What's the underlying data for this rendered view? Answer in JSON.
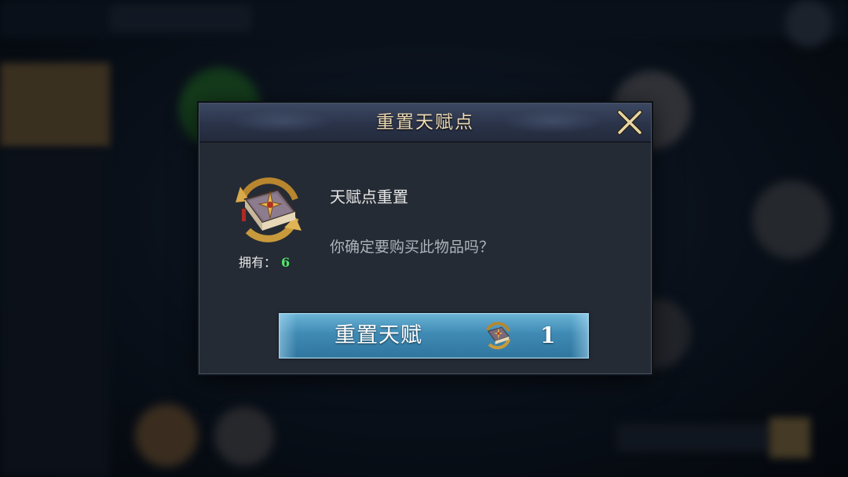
{
  "dialog": {
    "title": "重置天赋点",
    "close_icon": "close-x-icon",
    "item": {
      "icon": "talent-book-icon",
      "name": "天赋点重置",
      "owned_label": "拥有：",
      "owned_count": "6"
    },
    "confirm_text": "你确定要购买此物品吗？",
    "button": {
      "label": "重置天赋",
      "cost_icon": "talent-book-icon",
      "cost_amount": "1"
    }
  },
  "colors": {
    "title": "#ecd9b4",
    "owned_count": "#4ee86a",
    "button": "#3f8ab4",
    "dialog_bg": "#252b34"
  }
}
